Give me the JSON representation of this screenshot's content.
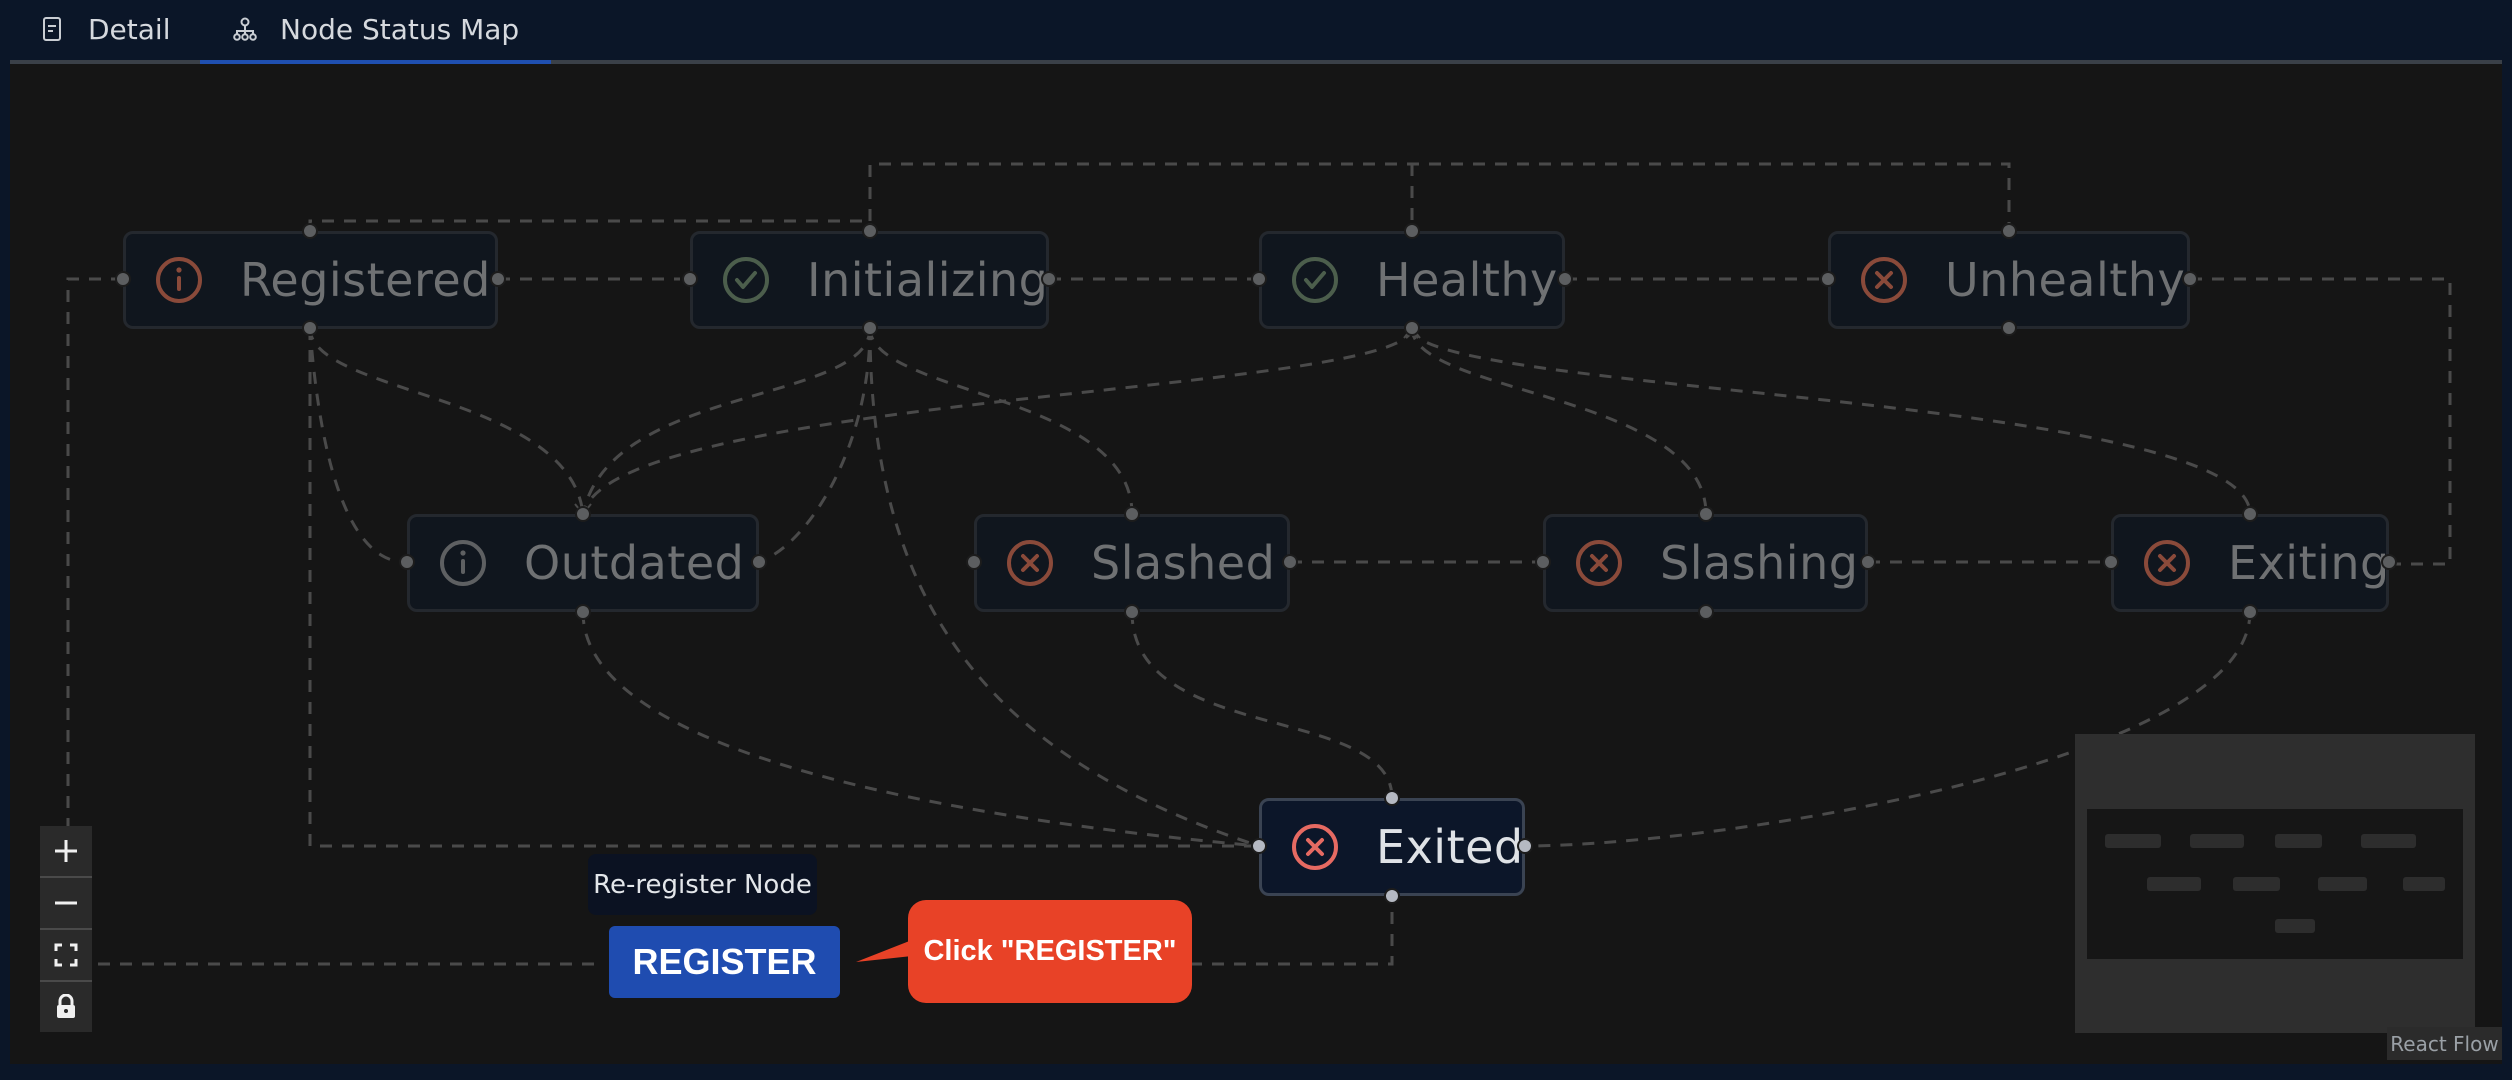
{
  "tabs": [
    {
      "label": "Detail",
      "icon": "document-icon",
      "active": false
    },
    {
      "label": "Node Status Map",
      "icon": "sitemap-icon",
      "active": true
    }
  ],
  "colors": {
    "accent": "#1f4fb0",
    "error_icon": "#e66a62",
    "error_icon_dim": "#8a4a3a",
    "success_icon_dim": "#4c5e4c",
    "info_icon_dim": "#8a4a3a",
    "callout": "#e84227"
  },
  "nodes": [
    {
      "id": "registered",
      "label": "Registered",
      "icon": "info-icon",
      "state": "dim"
    },
    {
      "id": "initializing",
      "label": "Initializing",
      "icon": "check-circle-icon",
      "state": "dim"
    },
    {
      "id": "healthy",
      "label": "Healthy",
      "icon": "check-circle-icon",
      "state": "dim"
    },
    {
      "id": "unhealthy",
      "label": "Unhealthy",
      "icon": "x-circle-icon",
      "state": "dim"
    },
    {
      "id": "outdated",
      "label": "Outdated",
      "icon": "info-icon",
      "state": "dim"
    },
    {
      "id": "slashed",
      "label": "Slashed",
      "icon": "x-circle-icon",
      "state": "dim"
    },
    {
      "id": "slashing",
      "label": "Slashing",
      "icon": "x-circle-icon",
      "state": "dim"
    },
    {
      "id": "exiting",
      "label": "Exiting",
      "icon": "x-circle-icon",
      "state": "dim"
    },
    {
      "id": "exited",
      "label": "Exited",
      "icon": "x-circle-icon",
      "state": "active"
    }
  ],
  "action": {
    "tooltip": "Re-register Node",
    "button_label": "REGISTER"
  },
  "callout": {
    "text": "Click \"REGISTER\""
  },
  "controls": [
    {
      "name": "zoom-in",
      "icon": "plus-icon"
    },
    {
      "name": "zoom-out",
      "icon": "minus-icon"
    },
    {
      "name": "fit-view",
      "icon": "fit-view-icon"
    },
    {
      "name": "lock",
      "icon": "lock-icon"
    }
  ],
  "attribution": "React Flow"
}
